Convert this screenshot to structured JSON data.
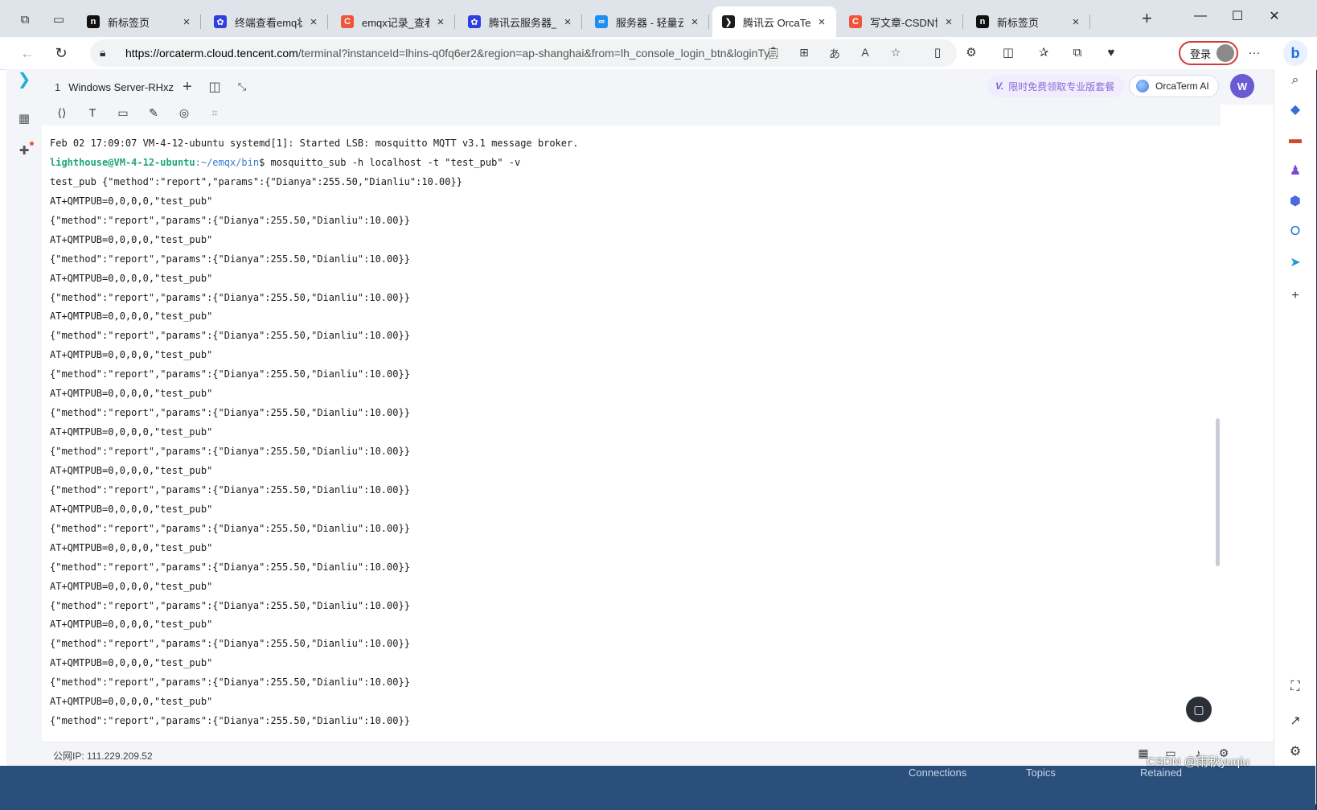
{
  "browser": {
    "tabs": [
      {
        "title": "新标签页",
        "favicon": "brand-icon",
        "color": "#111111",
        "active": false
      },
      {
        "title": "终端查看emq状态",
        "favicon": "baidu-paw-icon",
        "color": "#2f3fe0",
        "active": false
      },
      {
        "title": "emqx记录_查看em",
        "favicon": "csdn-c-icon",
        "color": "#f0543a",
        "active": false
      },
      {
        "title": "腾讯云服务器_百度",
        "favicon": "baidu-paw-icon",
        "color": "#2f3fe0",
        "active": false
      },
      {
        "title": "服务器 - 轻量云 - ",
        "favicon": "tencent-cloud-icon",
        "color": "#1e8ff0",
        "active": false
      },
      {
        "title": "腾讯云 OrcaTerm",
        "favicon": "orcaterm-icon",
        "color": "#1b1b1b",
        "active": true
      },
      {
        "title": "写文章-CSDN博客",
        "favicon": "csdn-c-icon",
        "color": "#f0543a",
        "active": false
      },
      {
        "title": "新标签页",
        "favicon": "brand-icon",
        "color": "#111111",
        "active": false
      }
    ],
    "url_host": "https://orcaterm.cloud.tencent.com",
    "url_rest": "/terminal?instanceId=lhins-q0fq6er2&region=ap-shanghai&from=lh_console_login_btn&loginTy...",
    "login_label": "登录"
  },
  "orcaterm": {
    "tab_number": "1",
    "tab_title": "Windows Server-RHxz",
    "promo_text": "限时免费领取专业版套餐",
    "promo_mark": "V.",
    "ai_label": "OrcaTerm AI",
    "user_initial": "W",
    "accent": "#1ea77a"
  },
  "terminal": {
    "lines": [
      {
        "type": "text",
        "text": "Feb 02 17:09:07 VM-4-12-ubuntu systemd[1]: Started LSB: mosquitto MQTT v3.1 message broker."
      },
      {
        "type": "prompt",
        "user": "lighthouse@VM-4-12-ubuntu",
        "path": ":~/emqx/bin",
        "cmd": "$ mosquitto_sub -h localhost -t \"test_pub\" -v"
      },
      {
        "type": "text",
        "text": "test_pub {\"method\":\"report\",\"params\":{\"Dianya\":255.50,\"Dianliu\":10.00}}"
      },
      {
        "type": "text",
        "text": "AT+QMTPUB=0,0,0,0,\"test_pub\""
      },
      {
        "type": "text",
        "text": "{\"method\":\"report\",\"params\":{\"Dianya\":255.50,\"Dianliu\":10.00}}"
      },
      {
        "type": "text",
        "text": "AT+QMTPUB=0,0,0,0,\"test_pub\""
      },
      {
        "type": "text",
        "text": "{\"method\":\"report\",\"params\":{\"Dianya\":255.50,\"Dianliu\":10.00}}"
      },
      {
        "type": "text",
        "text": "AT+QMTPUB=0,0,0,0,\"test_pub\""
      },
      {
        "type": "text",
        "text": "{\"method\":\"report\",\"params\":{\"Dianya\":255.50,\"Dianliu\":10.00}}"
      },
      {
        "type": "text",
        "text": "AT+QMTPUB=0,0,0,0,\"test_pub\""
      },
      {
        "type": "text",
        "text": "{\"method\":\"report\",\"params\":{\"Dianya\":255.50,\"Dianliu\":10.00}}"
      },
      {
        "type": "text",
        "text": "AT+QMTPUB=0,0,0,0,\"test_pub\""
      },
      {
        "type": "text",
        "text": "{\"method\":\"report\",\"params\":{\"Dianya\":255.50,\"Dianliu\":10.00}}"
      },
      {
        "type": "text",
        "text": "AT+QMTPUB=0,0,0,0,\"test_pub\""
      },
      {
        "type": "text",
        "text": "{\"method\":\"report\",\"params\":{\"Dianya\":255.50,\"Dianliu\":10.00}}"
      },
      {
        "type": "text",
        "text": "AT+QMTPUB=0,0,0,0,\"test_pub\""
      },
      {
        "type": "text",
        "text": "{\"method\":\"report\",\"params\":{\"Dianya\":255.50,\"Dianliu\":10.00}}"
      },
      {
        "type": "text",
        "text": "AT+QMTPUB=0,0,0,0,\"test_pub\""
      },
      {
        "type": "text",
        "text": "{\"method\":\"report\",\"params\":{\"Dianya\":255.50,\"Dianliu\":10.00}}"
      },
      {
        "type": "text",
        "text": "AT+QMTPUB=0,0,0,0,\"test_pub\""
      },
      {
        "type": "text",
        "text": "{\"method\":\"report\",\"params\":{\"Dianya\":255.50,\"Dianliu\":10.00}}"
      },
      {
        "type": "text",
        "text": "AT+QMTPUB=0,0,0,0,\"test_pub\""
      },
      {
        "type": "text",
        "text": "{\"method\":\"report\",\"params\":{\"Dianya\":255.50,\"Dianliu\":10.00}}"
      },
      {
        "type": "text",
        "text": "AT+QMTPUB=0,0,0,0,\"test_pub\""
      },
      {
        "type": "text",
        "text": "{\"method\":\"report\",\"params\":{\"Dianya\":255.50,\"Dianliu\":10.00}}"
      },
      {
        "type": "text",
        "text": "AT+QMTPUB=0,0,0,0,\"test_pub\""
      },
      {
        "type": "text",
        "text": "{\"method\":\"report\",\"params\":{\"Dianya\":255.50,\"Dianliu\":10.00}}"
      },
      {
        "type": "text",
        "text": "AT+QMTPUB=0,0,0,0,\"test_pub\""
      },
      {
        "type": "text",
        "text": "{\"method\":\"report\",\"params\":{\"Dianya\":255.50,\"Dianliu\":10.00}}"
      },
      {
        "type": "text",
        "text": "AT+QMTPUB=0,0,0,0,\"test_pub\""
      },
      {
        "type": "text",
        "text": "{\"method\":\"report\",\"params\":{\"Dianya\":255.50,\"Dianliu\":10.00}}"
      }
    ]
  },
  "statusbar": {
    "public_ip": "公网IP: 111.229.209.52"
  },
  "desktop": {
    "labels": [
      "Connections",
      "Topics",
      "Retained"
    ],
    "watermark": "CSDN @雨秋yuqiu"
  }
}
